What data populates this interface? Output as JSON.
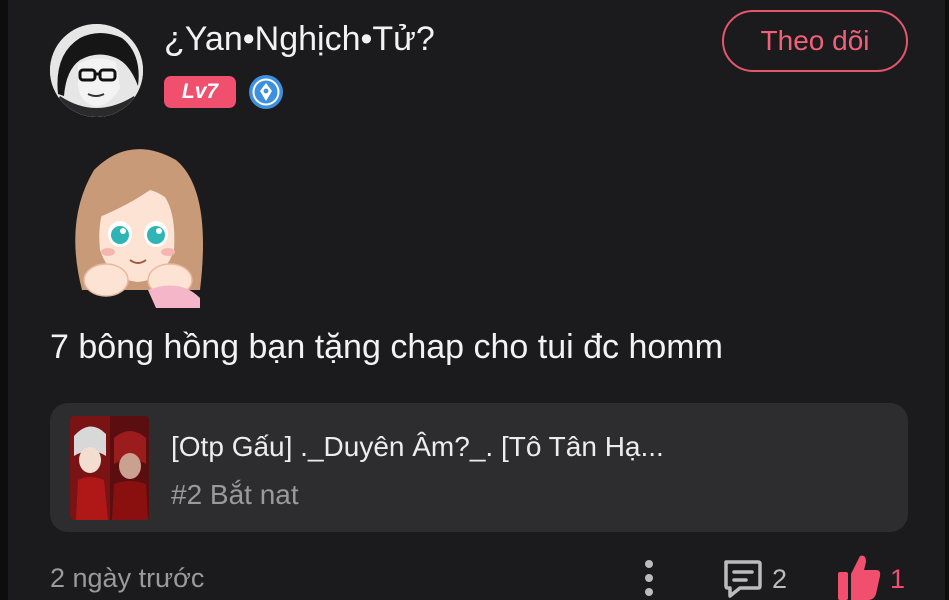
{
  "user": {
    "name": "¿Yan•Nghịch•Tử?",
    "level": "Lv7",
    "follow_label": "Theo dõi"
  },
  "comment": {
    "text": "7 bông hồng bạn tặng chap cho tui đc homm"
  },
  "story": {
    "title": "[Otp Gấu] ._Duyên Âm?_. [Tô Tân Hạ...",
    "chapter": "#2 Bắt nat"
  },
  "footer": {
    "timestamp": "2 ngày trước",
    "comment_count": "2",
    "like_count": "1"
  },
  "colors": {
    "accent": "#f0506e",
    "background": "#1b1b1d",
    "card": "#2d2d30",
    "muted_text": "#9a9a9a",
    "verified_blue": "#3d8fe0"
  },
  "icons": [
    "verified-icon",
    "more-icon",
    "comment-icon",
    "like-icon"
  ]
}
